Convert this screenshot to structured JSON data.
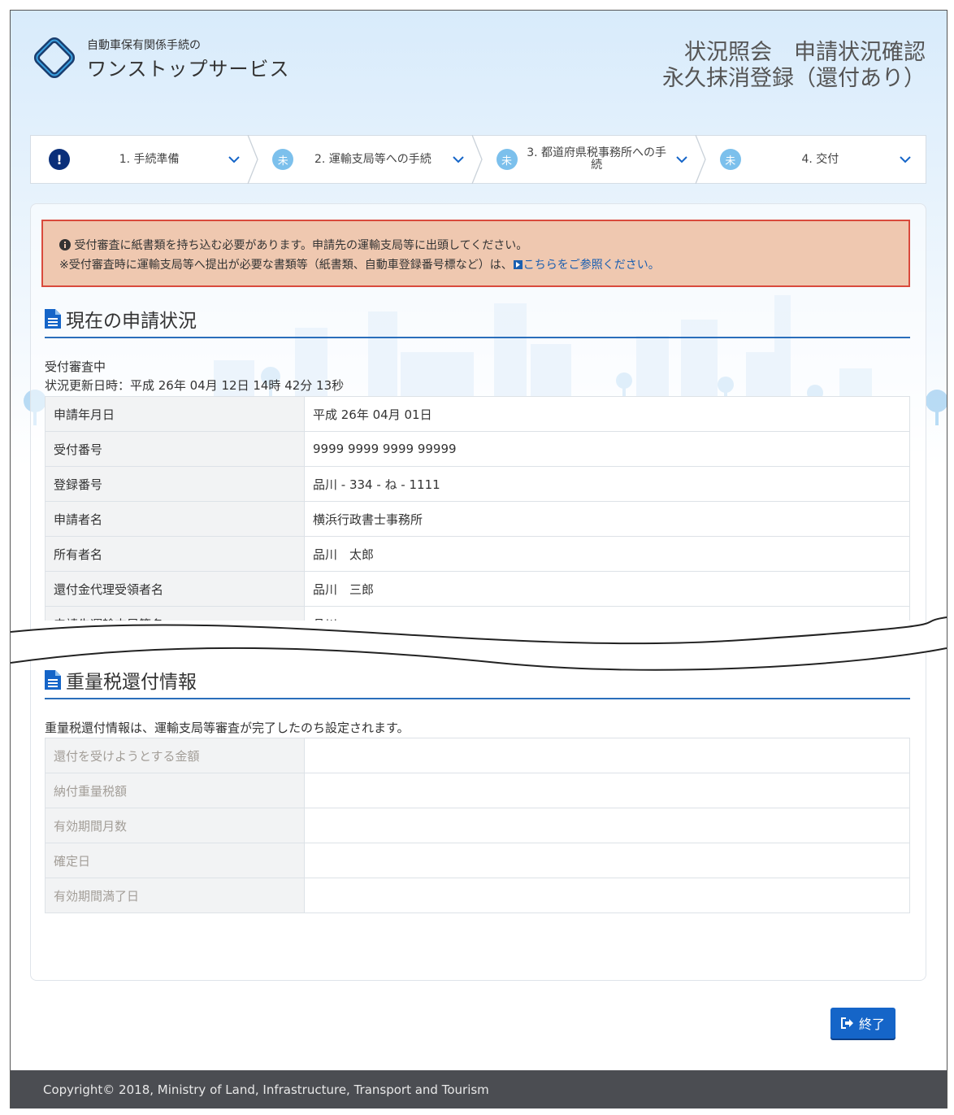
{
  "header": {
    "logo_sub": "自動車保有関係手続の",
    "logo_main": "ワンストップサービス",
    "title_line1": "状況照会　申請状況確認",
    "title_line2": "永久抹消登録（還付あり）"
  },
  "steps": [
    {
      "badge": "!",
      "icon": "exclamation-icon",
      "label": "1. 手続準備"
    },
    {
      "badge": "未",
      "icon": "pending-badge",
      "label": "2. 運輸支局等への手続"
    },
    {
      "badge": "未",
      "icon": "pending-badge",
      "label": "3. 都道府県税事務所への手続"
    },
    {
      "badge": "未",
      "icon": "pending-badge",
      "label": "4. 交付"
    }
  ],
  "alert": {
    "line1": "受付審査に紙書類を持ち込む必要があります。申請先の運輸支局等に出頭してください。",
    "line2_prefix": "※受付審査時に運輸支局等へ提出が必要な書類等（紙書類、自動車登録番号標など）は、",
    "link": "こちらをご参照ください。"
  },
  "status_section": {
    "title": "現在の申請状況",
    "status": "受付審査中",
    "updated": "状況更新日時：平成 26年 04月 12日 14時 42分 13秒",
    "rows": [
      {
        "label": "申請年月日",
        "value": "平成 26年 04月 01日"
      },
      {
        "label": "受付番号",
        "value": "9999 9999 9999 99999"
      },
      {
        "label": "登録番号",
        "value": "品川 - 334 - ね - 1111"
      },
      {
        "label": "申請者名",
        "value": "横浜行政書士事務所"
      },
      {
        "label": "所有者名",
        "value": "品川　太郎"
      },
      {
        "label": "還付金代理受領者名",
        "value": "品川　三郎"
      },
      {
        "label": "申請先運輸支局等名",
        "value": "品川"
      }
    ]
  },
  "refund_section": {
    "title": "重量税還付情報",
    "note": "重量税還付情報は、運輸支局等審査が完了したのち設定されます。",
    "rows": [
      {
        "label": "還付を受けようとする金額",
        "value": ""
      },
      {
        "label": "納付重量税額",
        "value": ""
      },
      {
        "label": "有効期間月数",
        "value": ""
      },
      {
        "label": "確定日",
        "value": ""
      },
      {
        "label": "有効期間満了日",
        "value": ""
      }
    ]
  },
  "finish_button": "終了",
  "footer": "Copyright© 2018, Ministry of Land, Infrastructure, Transport and Tourism",
  "colors": {
    "accent": "#1565c8",
    "alert_bg": "#efc8b0",
    "alert_border": "#d94a3c",
    "footer_bg": "#4b4d52"
  }
}
